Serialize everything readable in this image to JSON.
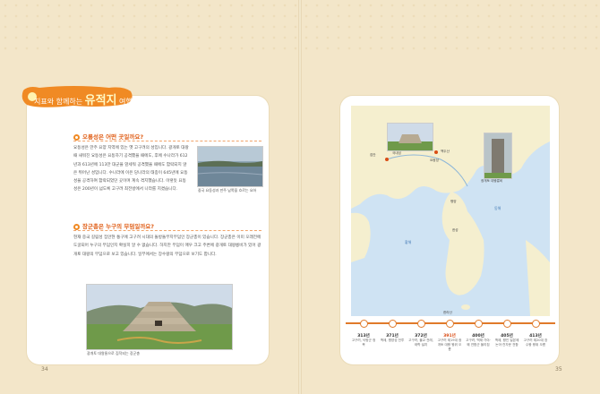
{
  "banner": {
    "prefix": "지표와 함께하는",
    "title": "유적지",
    "suffix": "여행"
  },
  "left_page": {
    "page_number": "34",
    "sections": [
      {
        "question": "오룡성은 어떤 곳일까요?",
        "body": "요동성은 만주 요양 지역에 있는 옛 고구려의 성입니다. 광개토 대왕 때 새워진 요동성은 요동하기 공격했을 때에도, 후에 수나라가 612년과 613년에 113만 대군을 앞세워 공격했을 때에도 함락되지 않은 뛰어난 성입니다. 수나라에 이은 당나라의 태종이 645년에 요동성을 공격하여 함락되었던 곳이며 계속 격지했습니다. 이렇듯 요동성은 200년이 넘도록 고구려 최전방에서 나라를 지켰습니다.",
        "photo_caption": "중국 요동성과 만주 남쪽을 흐르는 요하"
      },
      {
        "question": "장군총은 누구의 무덤일까요?",
        "body": "현재 중국 길림성 집안현 통구에 고구려 시대의 돌방돌무지무덤인 장군총이 있습니다. 장군총은 이미 오래전에 도굴되어 누구의 무덤인지 확실히 알 수 없습니다. 하지만 무덤이 매우 크고 주변에 광개토 대왕릉비가 있어 광개토 대왕의 무덤으로 보고 있습니다. 일부에서는 장수왕의 무덤으로 보기도 합니다.",
        "photo_caption": "광개토 대왕릉으로 짐작되는 장군총"
      }
    ]
  },
  "right_page": {
    "page_number": "35",
    "map_labels": {
      "jiban": "집안",
      "baekdu": "백두산",
      "hanseong": "한성",
      "pyeongyang": "평양",
      "east_sea": "동해",
      "yellow_sea": "황해",
      "hansan": "한라산",
      "gungnae": "국내성",
      "liaodong": "요동성",
      "stele_caption": "광개토 대왕릉비"
    },
    "timeline": [
      {
        "year": "313년",
        "desc": "고구려, 낙랑군 정복",
        "highlight": false
      },
      {
        "year": "371년",
        "desc": "백제, 평양성 전투",
        "highlight": false
      },
      {
        "year": "372년",
        "desc": "고구려, 불교 전래, 태학 설치",
        "highlight": false
      },
      {
        "year": "391년",
        "desc": "고구려 제19대 광개토 대왕 왕위 오름",
        "highlight": true
      },
      {
        "year": "400년",
        "desc": "고구려, 백제·가야·왜 연합군 물리침",
        "highlight": false
      },
      {
        "year": "405년",
        "desc": "백제, 왕인 일본에 논어·천자문 전함",
        "highlight": false
      },
      {
        "year": "413년",
        "desc": "고구려 제20대 장수왕 왕위 오름",
        "highlight": false
      }
    ]
  },
  "colors": {
    "accent": "#e07a2a",
    "banner": "#f08a24",
    "sea": "#cfe3f3",
    "land": "#f5efcf",
    "background": "#f3e6c9"
  }
}
